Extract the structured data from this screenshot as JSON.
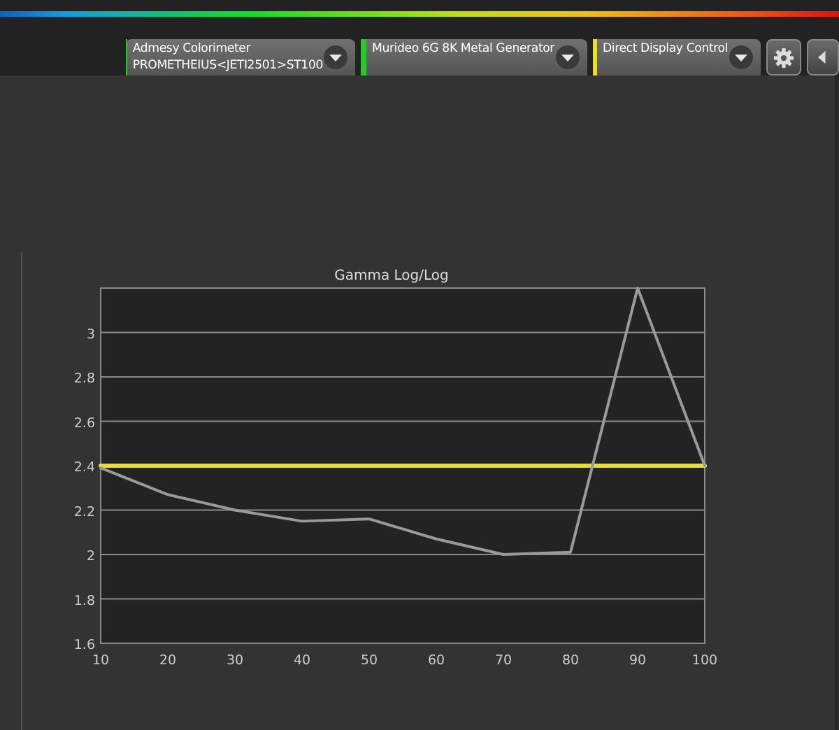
{
  "devices": [
    {
      "name": "Admesy Colorimeter",
      "detail": "PROMETHEIUS<JETI2501>ST100",
      "color": "#22cc22"
    },
    {
      "name": "Murideo 6G 8K Metal Generator",
      "color": "#22cc22"
    },
    {
      "name": "Direct Display Control",
      "color": "#e8e020"
    }
  ],
  "chart": {
    "chart_data": {
      "type": "line",
      "title": "Gamma Log/Log",
      "x": [
        10,
        20,
        30,
        40,
        50,
        60,
        70,
        80,
        90,
        100
      ],
      "xlim": [
        10,
        100
      ],
      "ylim": [
        1.6,
        3.2
      ],
      "xticks": [
        10,
        20,
        30,
        40,
        50,
        60,
        70,
        80,
        90,
        100
      ],
      "yticks": [
        1.6,
        1.8,
        2,
        2.2,
        2.4,
        2.6,
        2.8,
        3
      ],
      "series": [
        {
          "color": "#e8e030",
          "values": [
            2.4,
            2.4,
            2.4,
            2.4,
            2.4,
            2.4,
            2.4,
            2.4,
            2.4,
            2.4
          ]
        },
        {
          "color": "#9a9a9a",
          "values": [
            2.39,
            2.27,
            2.2,
            2.15,
            2.16,
            2.07,
            2.0,
            2.01,
            3.2,
            2.4
          ]
        }
      ]
    }
  }
}
